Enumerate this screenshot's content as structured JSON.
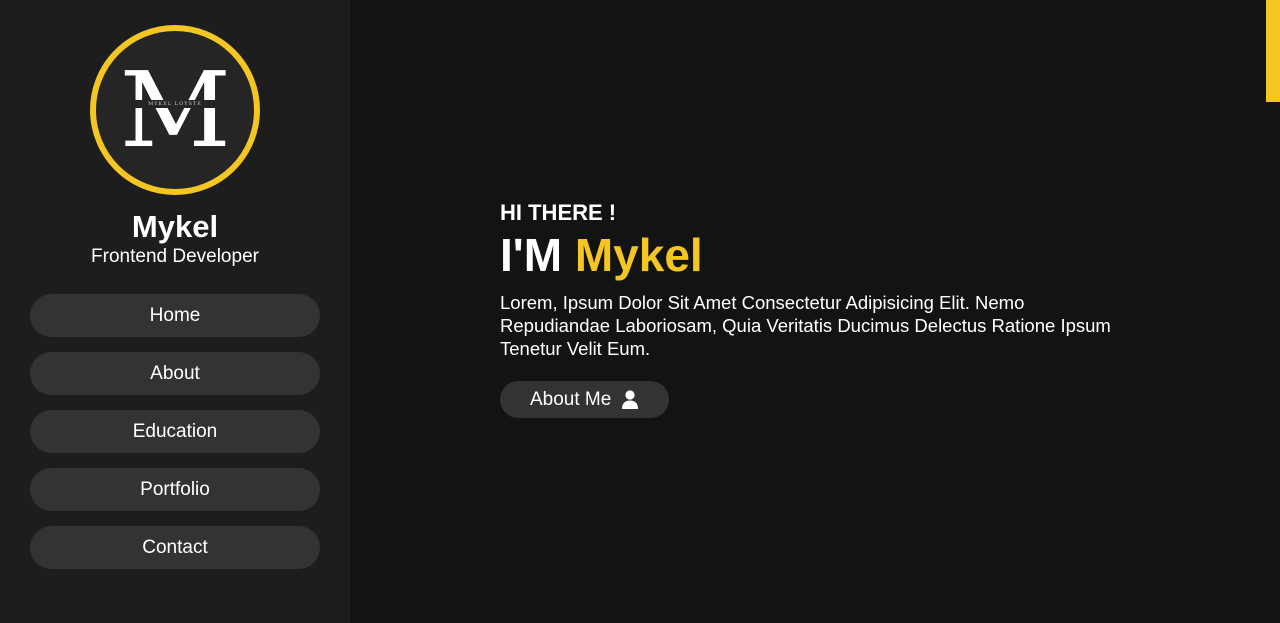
{
  "sidebar": {
    "logo": {
      "letter": "M",
      "small_text": "MYKEL LOYSTE",
      "ring_color": "#f3c623"
    },
    "name": "Mykel",
    "role": "Frontend Developer",
    "nav": [
      {
        "label": "Home"
      },
      {
        "label": "About"
      },
      {
        "label": "Education"
      },
      {
        "label": "Portfolio"
      },
      {
        "label": "Contact"
      }
    ]
  },
  "hero": {
    "greeting": "HI THERE !",
    "headline_prefix": "I'M ",
    "headline_name": "Mykel",
    "intro": "Lorem, Ipsum Dolor Sit Amet Consectetur Adipisicing Elit. Nemo Repudiandae Laboriosam, Quia Veritatis Ducimus Delectus Ratione Ipsum Tenetur Velit Eum.",
    "cta_label": "About Me",
    "cta_icon": "user-icon"
  },
  "theme": {
    "accent": "#f3c623",
    "background": "#131313",
    "sidebar_background": "#1d1d1d",
    "button_background": "#333333"
  }
}
